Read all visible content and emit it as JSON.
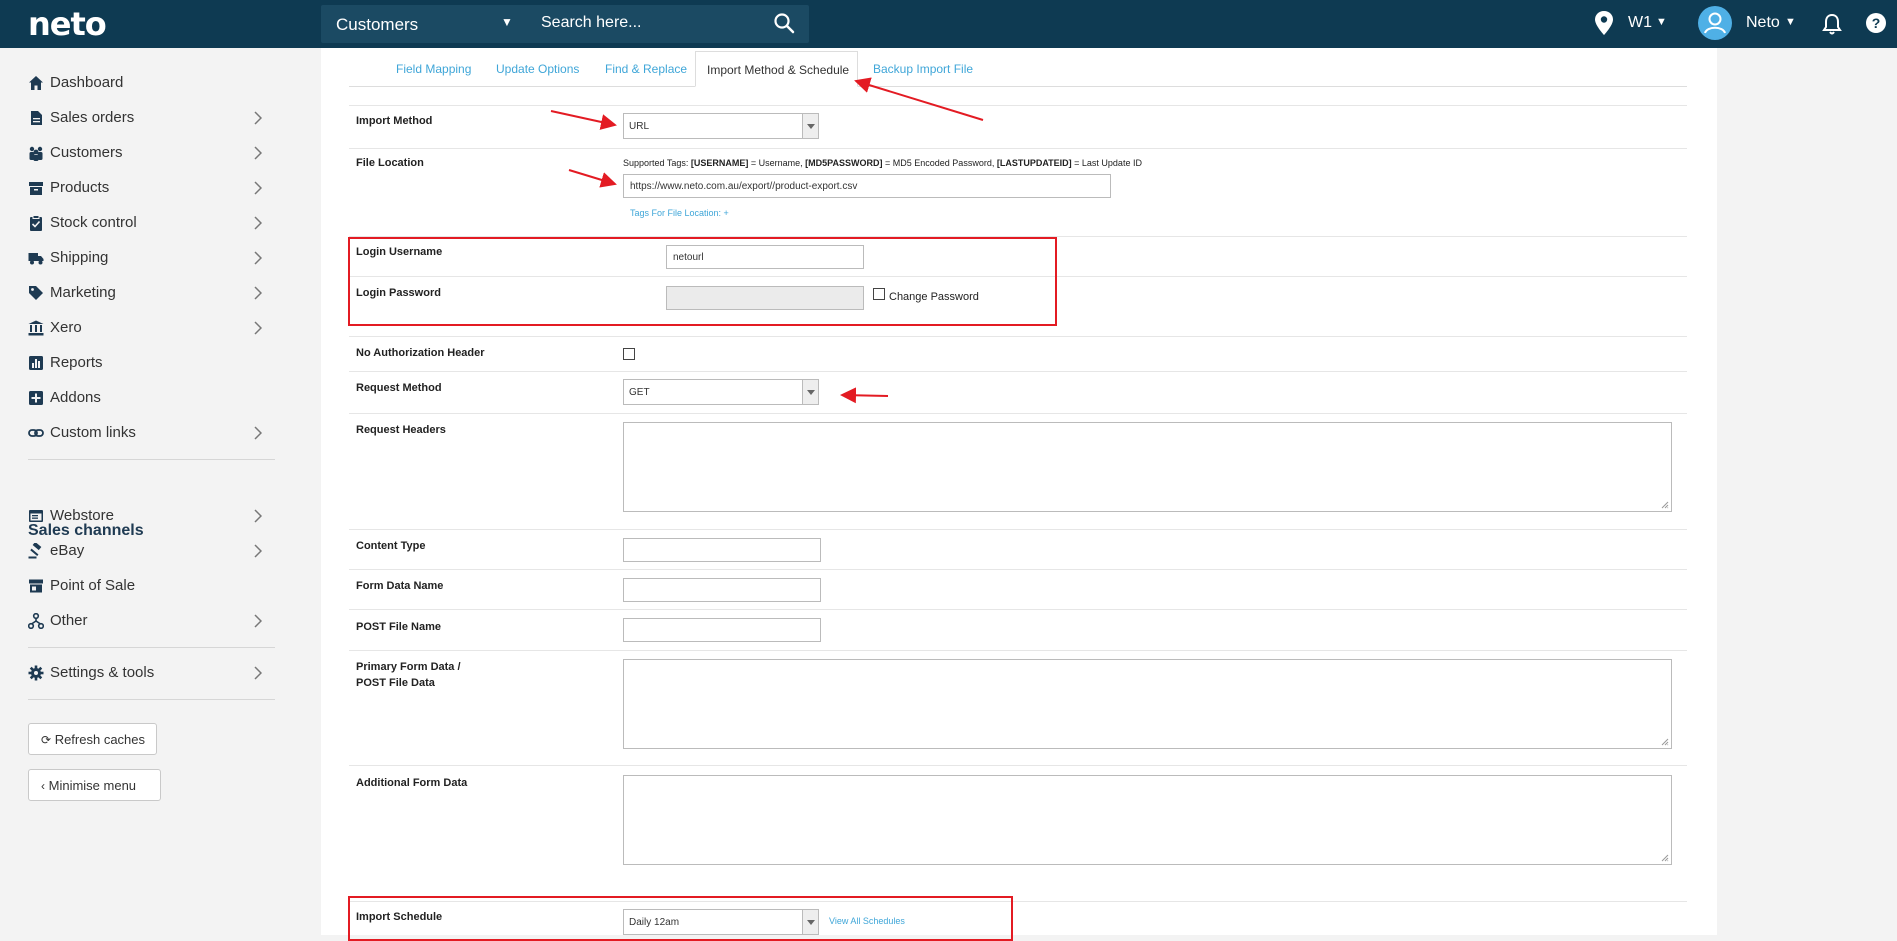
{
  "topbar": {
    "logo": "neto",
    "context_select": "Customers",
    "search_placeholder": "Search here...",
    "warehouse": "W1",
    "user": "Neto",
    "help": "?"
  },
  "sidebar": {
    "items": [
      {
        "label": "Dashboard",
        "icon": "home-icon"
      },
      {
        "label": "Sales orders",
        "icon": "document-icon"
      },
      {
        "label": "Customers",
        "icon": "users-icon"
      },
      {
        "label": "Products",
        "icon": "box-icon"
      },
      {
        "label": "Stock control",
        "icon": "clipboard-icon"
      },
      {
        "label": "Shipping",
        "icon": "truck-icon"
      },
      {
        "label": "Marketing",
        "icon": "tag-icon"
      },
      {
        "label": "Xero",
        "icon": "bank-icon"
      },
      {
        "label": "Reports",
        "icon": "chart-icon"
      },
      {
        "label": "Addons",
        "icon": "plus-square-icon"
      },
      {
        "label": "Custom links",
        "icon": "link-icon"
      }
    ],
    "sales_channels_heading": "Sales channels",
    "channels": [
      {
        "label": "Webstore",
        "icon": "browser-icon"
      },
      {
        "label": "eBay",
        "icon": "gavel-icon"
      },
      {
        "label": "Point of Sale",
        "icon": "store-icon"
      },
      {
        "label": "Other",
        "icon": "network-icon"
      }
    ],
    "settings": "Settings & tools",
    "refresh_caches": "Refresh caches",
    "minimise_menu": "Minimise menu"
  },
  "tabs": {
    "field_mapping": "Field Mapping",
    "update_options": "Update Options",
    "find_replace": "Find & Replace",
    "import_method_schedule": "Import Method & Schedule",
    "backup_import_file": "Backup Import File"
  },
  "form": {
    "import_method_label": "Import Method",
    "import_method_value": "URL",
    "file_location_label": "File Location",
    "supported_tags_prefix": "Supported Tags: ",
    "tag_username": "[USERNAME]",
    "tag_username_desc": " = Username, ",
    "tag_md5": "[MD5PASSWORD]",
    "tag_md5_desc": " = MD5 Encoded Password, ",
    "tag_lastupdate": "[LASTUPDATEID]",
    "tag_lastupdate_desc": " = Last Update ID",
    "file_location_value": "https://www.neto.com.au/export//product-export.csv",
    "tags_for_file_location": "Tags For File Location: +",
    "login_username_label": "Login Username",
    "login_username_value": "netourl",
    "login_password_label": "Login Password",
    "change_password": "Change Password",
    "no_auth_header_label": "No Authorization Header",
    "request_method_label": "Request Method",
    "request_method_value": "GET",
    "request_headers_label": "Request Headers",
    "content_type_label": "Content Type",
    "form_data_name_label": "Form Data Name",
    "post_file_name_label": "POST File Name",
    "primary_form_data_label_1": "Primary Form Data /",
    "primary_form_data_label_2": "POST File Data",
    "additional_form_data_label": "Additional Form Data",
    "import_schedule_label": "Import Schedule",
    "import_schedule_value": "Daily 12am",
    "view_all_schedules": "View All Schedules"
  },
  "colors": {
    "topbar": "#0e3a52",
    "accent": "#3fa6d8",
    "annotation_red": "#e31b23"
  }
}
